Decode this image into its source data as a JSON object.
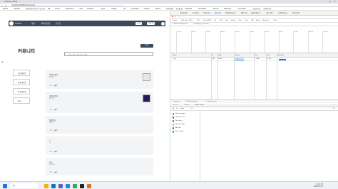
{
  "browser": {
    "tab_title": "Anthony-Chat",
    "url": "localhost:5000/community",
    "bookmarks": [
      "github",
      "classHR",
      "프론트엔드마스터즈",
      "티스토리",
      "DB",
      "Vercel",
      "Spearmint",
      "GPT",
      "tailscale",
      "sql.js",
      "Fastify",
      "jwt",
      "yumadata",
      "sureold",
      "Notion",
      "이미지검색",
      "포트폴리오",
      "Dribbble",
      "Cloudflare",
      "Framer",
      "Pinterest",
      "Can't Stop",
      "오늘의 도전",
      "이력/자소서"
    ]
  },
  "site": {
    "logo_text": "안녕하세요",
    "nav": [
      "정책",
      "패키지소개",
      "조가로"
    ],
    "login_label": "로그인",
    "signup_label": "회원가입",
    "heading": "커뮤니티",
    "write_label": "글쓰기",
    "search_placeholder": "제목, 내용, 글 작성자로 검색",
    "categories": [
      "초급게시판",
      "자유게시판",
      "자료게시판",
      "기타"
    ],
    "cards": [
      {
        "title": "가족의 정서",
        "author": "정한빈님",
        "body": "",
        "likes": "0",
        "comments": "0",
        "thumb": "light"
      },
      {
        "title": "가족의 정서",
        "author": "정한빈님",
        "body": "",
        "likes": "0",
        "comments": "0",
        "thumb": "dark"
      },
      {
        "title": "정한빈님",
        "author": "정한빈",
        "body": "",
        "likes": "0",
        "comments": "0",
        "thumb": ""
      },
      {
        "title": "ㅇ",
        "author": "ㅇ",
        "body": "",
        "likes": "0",
        "comments": "0",
        "thumb": ""
      },
      {
        "title": "ㅂㅂ",
        "author": "정한빈님",
        "body": "",
        "likes": "0",
        "comments": "0",
        "thumb": ""
      }
    ]
  },
  "devtools": {
    "tabs": [
      "Elements",
      "Console",
      "Sources",
      "Network",
      "Performance",
      "Memory",
      "Application",
      "Security",
      "Lighthouse",
      "Recorder"
    ],
    "active_tab": "Network",
    "filters": [
      "Invert",
      "Hide data URLs",
      "All",
      "Fetch/XHR",
      "JS",
      "CSS",
      "Img",
      "Media",
      "Font",
      "Doc",
      "WS",
      "Wasm",
      "Manifest",
      "Other"
    ],
    "checkboxes": [
      "Blocked Requests",
      "3rd-party requests"
    ],
    "timeline_ticks": [
      "10 ms",
      "20 ms",
      "30 ms",
      "40 ms",
      "50 ms",
      "60 ms",
      "70 ms",
      "80 ms",
      "90 ms",
      "100 ms",
      "110 ms"
    ],
    "columns": [
      "Name",
      "St...",
      "Type",
      "Initiator",
      "Size",
      "Time",
      "Waterfall"
    ],
    "rows": [
      {
        "name": "?_rsc",
        "status": "200",
        "type": "fetch",
        "initiator": "webpack.js:1",
        "size": "1.2 kB",
        "time": "17 ms"
      }
    ],
    "status_bar": [
      "1 requests",
      "1.2 kB transferred",
      "1.2 kB resources"
    ],
    "drawer_tabs": [
      "Console",
      "Issues",
      "What's New"
    ],
    "console_filter": "Filter",
    "console_side": [
      "No messages",
      "No user mes...",
      "No errors",
      "No warnings",
      "No info",
      "No verbose"
    ],
    "console_side_colors": [
      "#777777",
      "#555555",
      "#d93025",
      "#f9ab00",
      "#1a73e8",
      "#777777"
    ]
  },
  "taskbar": {
    "search_label": "검색",
    "time": "오후 2:50",
    "date": "2023-07-17"
  }
}
